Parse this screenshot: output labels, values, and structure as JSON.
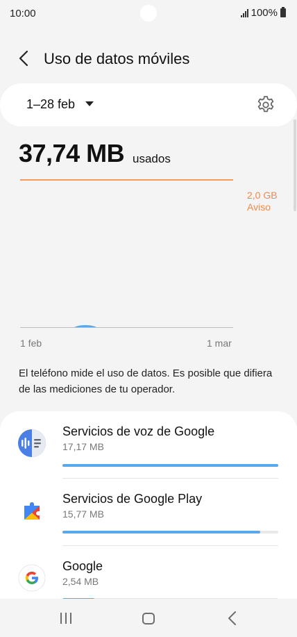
{
  "status_bar": {
    "time": "10:00",
    "battery": "100%"
  },
  "header": {
    "title": "Uso de datos móviles",
    "back_icon": "chevron-left-icon"
  },
  "date_selector": {
    "range": "1–28 feb",
    "settings_icon": "gear-icon"
  },
  "usage": {
    "value": "37,74 MB",
    "unit": "usados"
  },
  "chart_data": {
    "type": "area",
    "x_tick_labels": [
      "1 feb",
      "1 mar"
    ],
    "limit": {
      "value": "2,0 GB",
      "label": "Aviso",
      "color": "#f0894a"
    },
    "series_color": "#5aa8ea"
  },
  "info_text": "El teléfono mide el uso de datos. Es posible que difiera de las mediciones de tu operador.",
  "apps": [
    {
      "name": "Servicios de voz de Google",
      "usage": "17,17 MB",
      "fraction": 1.0,
      "icon": "google-voice-icon"
    },
    {
      "name": "Servicios de Google Play",
      "usage": "15,77 MB",
      "fraction": 0.918,
      "icon": "google-play-services-icon"
    },
    {
      "name": "Google",
      "usage": "2,54 MB",
      "fraction": 0.148,
      "icon": "google-icon"
    }
  ],
  "colors": {
    "accent": "#5aa8ea",
    "warning": "#f0894a",
    "background": "#f4f4f4"
  },
  "nav": {
    "recent_icon": "recent-apps-icon",
    "home_icon": "home-icon",
    "back_icon": "back-icon"
  }
}
